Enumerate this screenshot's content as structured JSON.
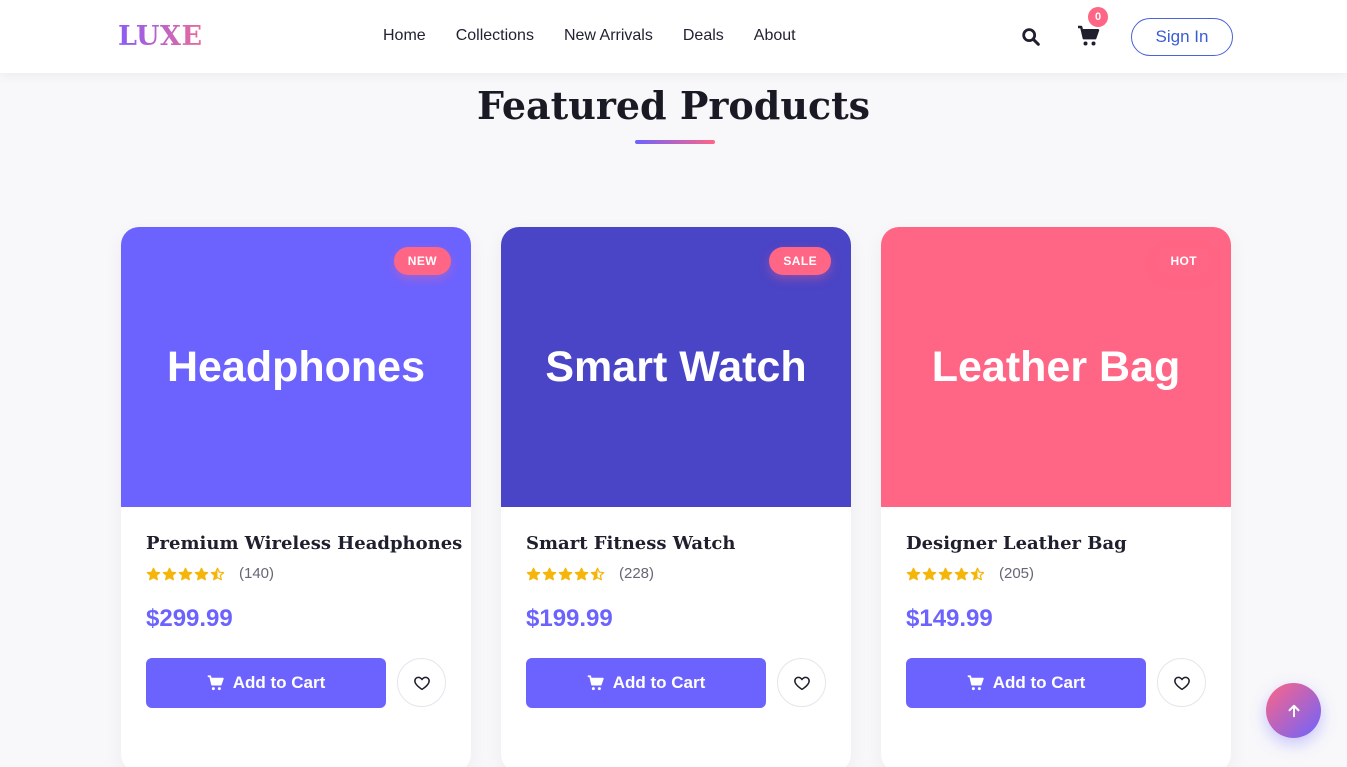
{
  "brand": {
    "logo": "LUXE"
  },
  "nav": {
    "links": [
      "Home",
      "Collections",
      "New Arrivals",
      "Deals",
      "About"
    ],
    "cart_count": "0",
    "sign_in": "Sign In",
    "icons": {
      "search": "search-icon",
      "cart": "cart-icon"
    }
  },
  "section": {
    "title": "Featured Products"
  },
  "products": [
    {
      "image_label": "Headphones",
      "badge": "NEW",
      "name": "Premium Wireless Headphones",
      "rating": 4.5,
      "rating_count": "(140)",
      "price": "$299.99",
      "cta": "Add to Cart",
      "color": "#6c63ff"
    },
    {
      "image_label": "Smart Watch",
      "badge": "SALE",
      "name": "Smart Fitness Watch",
      "rating": 4.5,
      "rating_count": "(228)",
      "price": "$199.99",
      "cta": "Add to Cart",
      "color": "#4a44c6"
    },
    {
      "image_label": "Leather Bag",
      "badge": "HOT",
      "name": "Designer Leather Bag",
      "rating": 4.5,
      "rating_count": "(205)",
      "price": "$149.99",
      "cta": "Add to Cart",
      "color": "#ff6584"
    }
  ],
  "colors": {
    "accent": "#6c63ff",
    "pink": "#ff6584",
    "star": "#f5b50a"
  },
  "scroll_top": {
    "icon": "arrow-up-icon"
  }
}
